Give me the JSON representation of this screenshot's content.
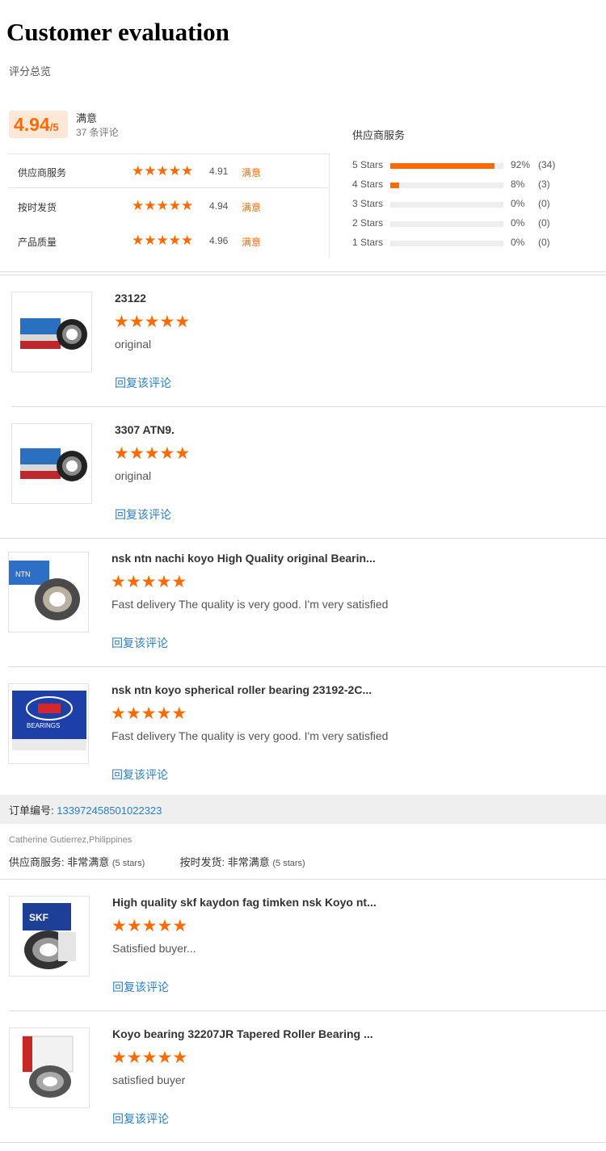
{
  "page": {
    "title": "Customer evaluation",
    "subtitle": "评分总览"
  },
  "summary": {
    "score": "4.94",
    "score_suffix": "/5",
    "mood": "满意",
    "count": "37 条评论",
    "ratings": [
      {
        "label": "供应商服务",
        "score": "4.91",
        "mood": "满意",
        "stars": 5
      },
      {
        "label": "按时发货",
        "score": "4.94",
        "mood": "满意",
        "stars": 5
      },
      {
        "label": "产品质量",
        "score": "4.96",
        "mood": "满意",
        "stars": 5
      }
    ]
  },
  "distribution": {
    "title": "供应商服务",
    "rows": [
      {
        "label": "5 Stars",
        "percent": "92%",
        "count": "(34)",
        "fill": 0.92
      },
      {
        "label": "4 Stars",
        "percent": "8%",
        "count": "(3)",
        "fill": 0.08
      },
      {
        "label": "3 Stars",
        "percent": "0%",
        "count": "(0)",
        "fill": 0
      },
      {
        "label": "2 Stars",
        "percent": "0%",
        "count": "(0)",
        "fill": 0
      },
      {
        "label": "1 Stars",
        "percent": "0%",
        "count": "(0)",
        "fill": 0
      }
    ]
  },
  "reviews": [
    {
      "title": "23122",
      "stars": 5,
      "text": "original",
      "reply": "回复该评论",
      "image": "bearing-blue-box"
    },
    {
      "title": "3307 ATN9.",
      "stars": 5,
      "text": "original",
      "reply": "回复该评论",
      "image": "bearing-blue-box"
    },
    {
      "title": "nsk ntn nachi koyo High Quality original Bearin...",
      "stars": 5,
      "text": "Fast delivery The quality is very good. I'm very satisfied",
      "reply": "回复该评论",
      "image": "ntn-roller-bearing"
    },
    {
      "title": "nsk ntn koyo spherical roller bearing 23192-2C...",
      "stars": 5,
      "text": "Fast delivery The quality is very good. I'm very satisfied",
      "reply": "回复该评论",
      "image": "nsk-bearings-box"
    },
    {
      "title": "High quality skf kaydon fag timken nsk Koyo nt...",
      "stars": 5,
      "text": "Satisfied buyer...",
      "reply": "回复该评论",
      "image": "skf-box-bearing"
    },
    {
      "title": "Koyo bearing 32207JR Tapered Roller Bearing ...",
      "stars": 5,
      "text": "satisfied buyer",
      "reply": "回复该评论",
      "image": "koyo-tapered-bearing"
    }
  ],
  "order": {
    "label": "订单编号:",
    "number": "133972458501022323",
    "buyer": "Catherine Gutierrez,Philippines",
    "service_label": "供应商服务:",
    "service_value": "非常满意",
    "service_stars": "(5 stars)",
    "delivery_label": "按时发货:",
    "delivery_value": "非常满意",
    "delivery_stars": "(5 stars)"
  },
  "colors": {
    "accent": "#ff6a00",
    "link": "#2a7ec0",
    "score_bg": "#fde8d8"
  }
}
